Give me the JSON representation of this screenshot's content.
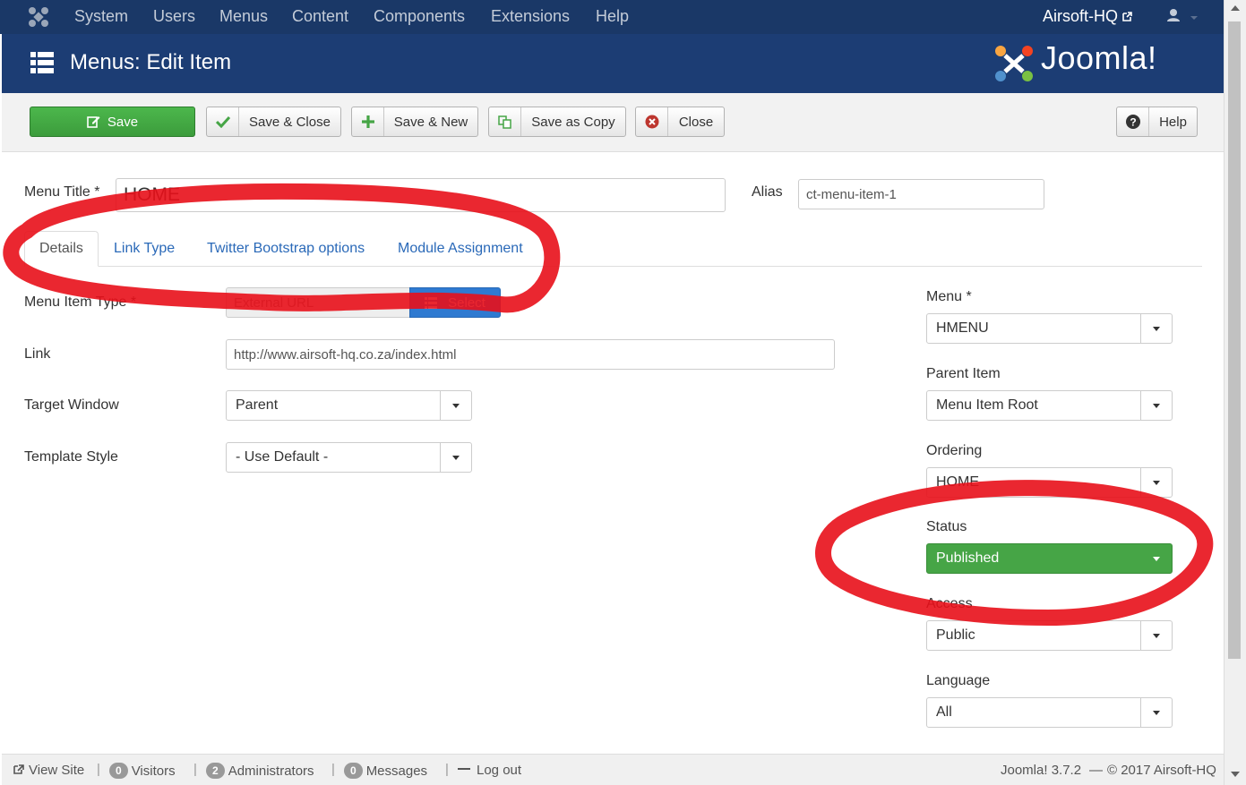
{
  "topnav": {
    "items": [
      "System",
      "Users",
      "Menus",
      "Content",
      "Components",
      "Extensions",
      "Help"
    ],
    "site_name": "Airsoft-HQ"
  },
  "header": {
    "title": "Menus: Edit Item",
    "brand": "Joomla!"
  },
  "toolbar": {
    "save": "Save",
    "save_close": "Save & Close",
    "save_new": "Save & New",
    "save_copy": "Save as Copy",
    "close": "Close",
    "help": "Help"
  },
  "form": {
    "menu_title_label": "Menu Title *",
    "menu_title_value": "HOME",
    "alias_label": "Alias",
    "alias_value": "ct-menu-item-1"
  },
  "tabs": [
    "Details",
    "Link Type",
    "Twitter Bootstrap options",
    "Module Assignment"
  ],
  "details": {
    "menu_item_type_label": "Menu Item Type *",
    "menu_item_type_value": "External URL",
    "select_label": "Select",
    "link_label": "Link",
    "link_value": "http://www.airsoft-hq.co.za/index.html",
    "target_label": "Target Window",
    "target_value": "Parent",
    "template_label": "Template Style",
    "template_value": "- Use Default -"
  },
  "sidebar": {
    "menu_label": "Menu *",
    "menu_value": "HMENU",
    "parent_label": "Parent Item",
    "parent_value": "Menu Item Root",
    "ordering_label": "Ordering",
    "ordering_value": "HOME",
    "status_label": "Status",
    "status_value": "Published",
    "access_label": "Access",
    "access_value": "Public",
    "language_label": "Language",
    "language_value": "All"
  },
  "footer": {
    "view_site": "View Site",
    "visitors_count": "0",
    "visitors": "Visitors",
    "admins_count": "2",
    "admins": "Administrators",
    "messages_count": "0",
    "messages": "Messages",
    "logout": "Log out",
    "version": "Joomla! 3.7.2",
    "copyright": "© 2017 Airsoft-HQ"
  },
  "colors": {
    "nav": "#1a3867",
    "header": "#1c3d74",
    "save_green": "#46a546",
    "link_blue": "#2a69b8",
    "annotation_red": "#e8101a"
  }
}
